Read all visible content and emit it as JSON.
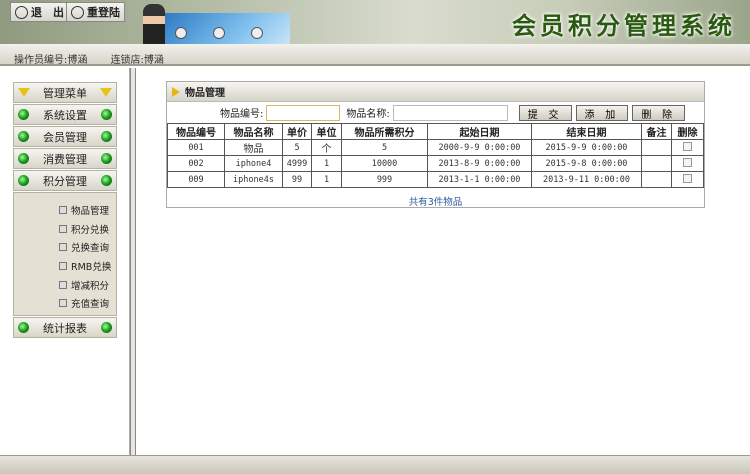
{
  "header": {
    "logout_label": "退　出",
    "relogin_label": "重登陆",
    "system_title": "会员积分管理系统"
  },
  "infobar": {
    "operator": "操作员编号:博涵",
    "store": "连锁店:博涵"
  },
  "menu": {
    "title": "管理菜单",
    "items": [
      "系统设置",
      "会员管理",
      "消费管理",
      "积分管理"
    ],
    "sub_items": [
      "物品管理",
      "积分兑换",
      "兑换查询",
      "RMB兑换",
      "增减积分",
      "充值查询"
    ],
    "last_item": "统计报表"
  },
  "panel": {
    "title": "物品管理",
    "search": {
      "code_label": "物品编号:",
      "code_value": "",
      "name_label": "物品名称:",
      "name_value": ""
    },
    "buttons": {
      "submit": "提 交",
      "add": "添 加",
      "delete": "删 除"
    },
    "columns": [
      "物品编号",
      "物品名称",
      "单价",
      "单位",
      "物品所需积分",
      "起始日期",
      "结束日期",
      "备注",
      "删除"
    ],
    "rows": [
      [
        "001",
        "物品",
        "5",
        "个",
        "5",
        "2000-9-9 0:00:00",
        "2015-9-9 0:00:00",
        ""
      ],
      [
        "002",
        "iphone4",
        "4999",
        "1",
        "10000",
        "2013-8-9 0:00:00",
        "2015-9-8 0:00:00",
        ""
      ],
      [
        "009",
        "iphone4s",
        "99",
        "1",
        "999",
        "2013-1-1 0:00:00",
        "2013-9-11 0:00:00",
        ""
      ]
    ],
    "footer": "共有3件物品"
  }
}
